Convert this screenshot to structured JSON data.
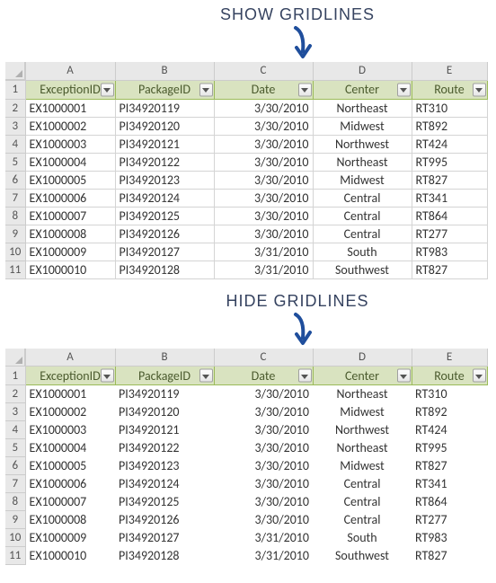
{
  "caption_show": "SHOW GRIDLINES",
  "caption_hide": "HIDE GRIDLINES",
  "col_letters": [
    "A",
    "B",
    "C",
    "D",
    "E"
  ],
  "headers": {
    "exception_id": "ExceptionID",
    "package_id": "PackageID",
    "date": "Date",
    "center": "Center",
    "route": "Route"
  },
  "row_numbers": [
    "1",
    "2",
    "3",
    "4",
    "5",
    "6",
    "7",
    "8",
    "9",
    "10",
    "11"
  ],
  "rows": [
    {
      "exception_id": "EX1000001",
      "package_id": "PI34920119",
      "date": "3/30/2010",
      "center": "Northeast",
      "route": "RT310"
    },
    {
      "exception_id": "EX1000002",
      "package_id": "PI34920120",
      "date": "3/30/2010",
      "center": "Midwest",
      "route": "RT892"
    },
    {
      "exception_id": "EX1000003",
      "package_id": "PI34920121",
      "date": "3/30/2010",
      "center": "Northwest",
      "route": "RT424"
    },
    {
      "exception_id": "EX1000004",
      "package_id": "PI34920122",
      "date": "3/30/2010",
      "center": "Northeast",
      "route": "RT995"
    },
    {
      "exception_id": "EX1000005",
      "package_id": "PI34920123",
      "date": "3/30/2010",
      "center": "Midwest",
      "route": "RT827"
    },
    {
      "exception_id": "EX1000006",
      "package_id": "PI34920124",
      "date": "3/30/2010",
      "center": "Central",
      "route": "RT341"
    },
    {
      "exception_id": "EX1000007",
      "package_id": "PI34920125",
      "date": "3/30/2010",
      "center": "Central",
      "route": "RT864"
    },
    {
      "exception_id": "EX1000008",
      "package_id": "PI34920126",
      "date": "3/30/2010",
      "center": "Central",
      "route": "RT277"
    },
    {
      "exception_id": "EX1000009",
      "package_id": "PI34920127",
      "date": "3/31/2010",
      "center": "South",
      "route": "RT983"
    },
    {
      "exception_id": "EX1000010",
      "package_id": "PI34920128",
      "date": "3/31/2010",
      "center": "Southwest",
      "route": "RT827"
    }
  ]
}
